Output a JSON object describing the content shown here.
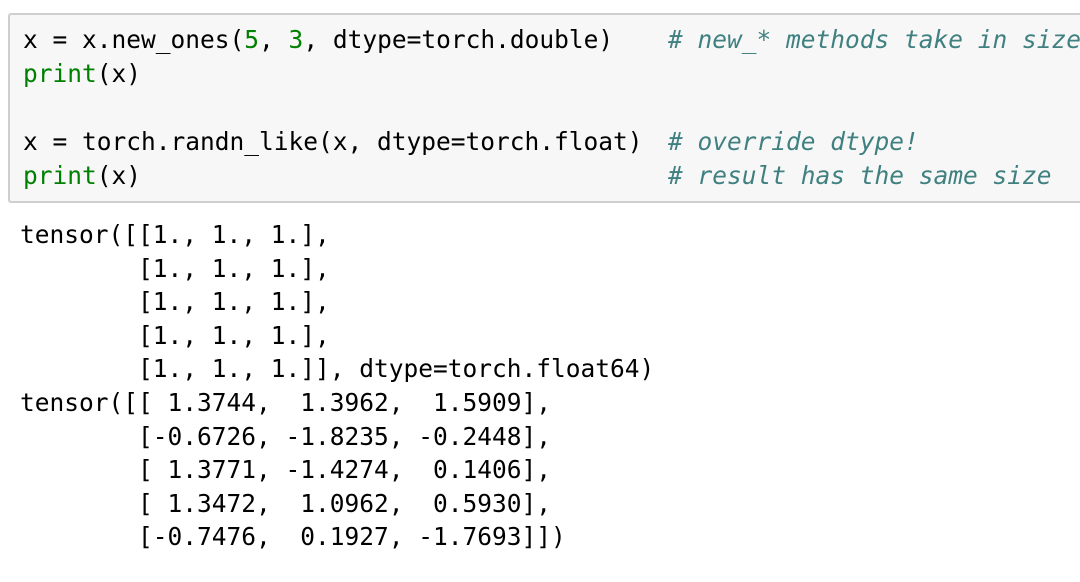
{
  "input_cell": {
    "lines": [
      {
        "segments": [
          {
            "text": "x = x.new_ones(",
            "style": "plain"
          },
          {
            "text": "5",
            "style": "number"
          },
          {
            "text": ", ",
            "style": "plain"
          },
          {
            "text": "3",
            "style": "number"
          },
          {
            "text": ", dtype=torch.double)",
            "style": "plain"
          }
        ],
        "comment": "# new_* methods take in sizes"
      },
      {
        "segments": [
          {
            "text": "print",
            "style": "keyword"
          },
          {
            "text": "(x)",
            "style": "plain"
          }
        ],
        "comment": ""
      },
      {
        "segments": [],
        "comment": ""
      },
      {
        "segments": [
          {
            "text": "x = torch.randn_like(x, dtype=torch.float)",
            "style": "plain"
          }
        ],
        "comment": "# override dtype!"
      },
      {
        "segments": [
          {
            "text": "print",
            "style": "keyword"
          },
          {
            "text": "(x)",
            "style": "plain"
          }
        ],
        "comment": "# result has the same size"
      }
    ]
  },
  "output": {
    "lines": [
      "tensor([[1., 1., 1.],",
      "        [1., 1., 1.],",
      "        [1., 1., 1.],",
      "        [1., 1., 1.],",
      "        [1., 1., 1.]], dtype=torch.float64)",
      "tensor([[ 1.3744,  1.3962,  1.5909],",
      "        [-0.6726, -1.8235, -0.2448],",
      "        [ 1.3771, -1.4274,  0.1406],",
      "        [ 1.3472,  1.0962,  0.5930],",
      "        [-0.7476,  0.1927, -1.7693]])"
    ]
  },
  "colors": {
    "cell_background": "#f7f7f7",
    "cell_border": "#cfcfcf",
    "keyword": "#008000",
    "number": "#008000",
    "comment": "#408080",
    "text": "#000000"
  }
}
